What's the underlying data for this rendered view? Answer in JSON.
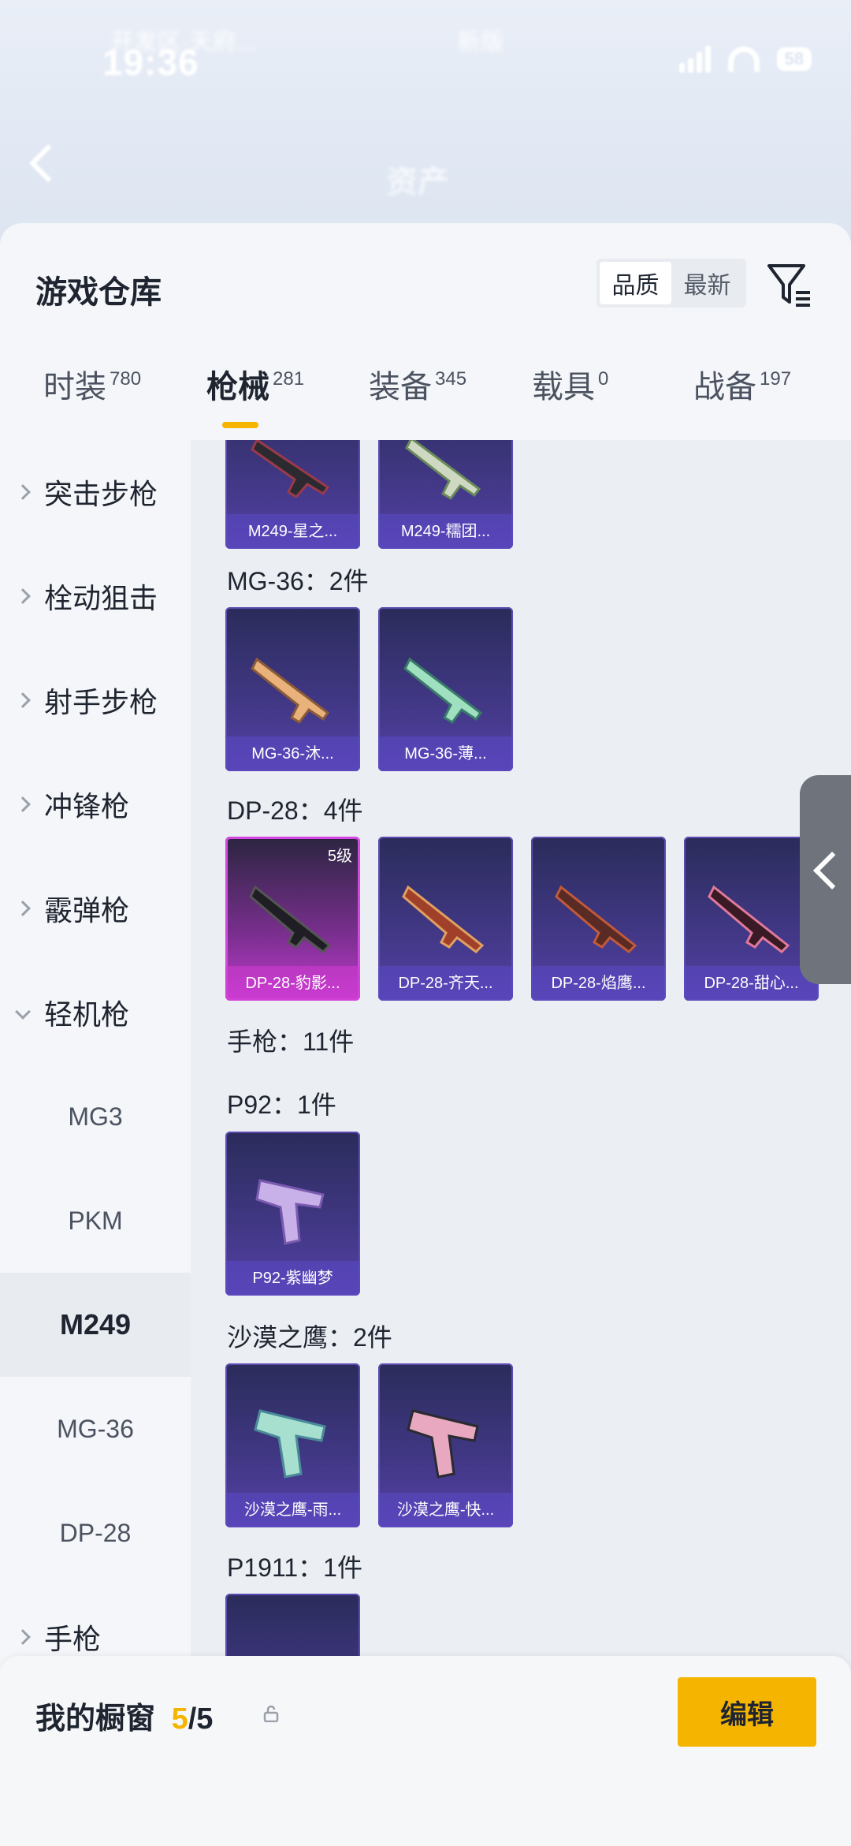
{
  "status": {
    "time": "19:36",
    "battery": "58",
    "blurred_left": "开发区·天府...",
    "blurred_center": "新版"
  },
  "header": {
    "title": "资产"
  },
  "sheet": {
    "title": "游戏仓库",
    "sort_options": [
      "品质",
      "最新"
    ],
    "sort_active": "品质"
  },
  "tabs": [
    {
      "label": "时装",
      "count": "780"
    },
    {
      "label": "枪械",
      "count": "281",
      "active": true
    },
    {
      "label": "装备",
      "count": "345"
    },
    {
      "label": "载具",
      "count": "0"
    },
    {
      "label": "战备",
      "count": "197"
    }
  ],
  "nav": {
    "categories": [
      "突击步枪",
      "栓动狙击",
      "射手步枪",
      "冲锋枪",
      "霰弹枪",
      "轻机枪",
      "手枪"
    ],
    "subitems": [
      "MG3",
      "PKM",
      "M249",
      "MG-36",
      "DP-28"
    ],
    "selected": "M249"
  },
  "content": {
    "m249_cards": [
      "M249-星之...",
      "M249-糯团..."
    ],
    "mg36_label": "MG-36：2件",
    "mg36_cards": [
      "MG-36-沐...",
      "MG-36-薄..."
    ],
    "dp28_label": "DP-28：4件",
    "dp28_cards": [
      "DP-28-豹影...",
      "DP-28-齐天...",
      "DP-28-焰鹰...",
      "DP-28-甜心..."
    ],
    "dp28_level": "5级",
    "pistol_label": "手枪：11件",
    "p92_label": "P92：1件",
    "p92_cards": [
      "P92-紫幽梦"
    ],
    "deagle_label": "沙漠之鹰：2件",
    "deagle_cards": [
      "沙漠之鹰-雨...",
      "沙漠之鹰-快..."
    ],
    "p1911_label": "P1911：1件"
  },
  "bottom": {
    "window_label": "我的橱窗",
    "window_current": "5",
    "window_total": "/5",
    "edit_label": "编辑"
  },
  "colors": {
    "accent": "#f5b400",
    "card_bg": "#463a8e",
    "card_pink": "#c23bd0"
  }
}
